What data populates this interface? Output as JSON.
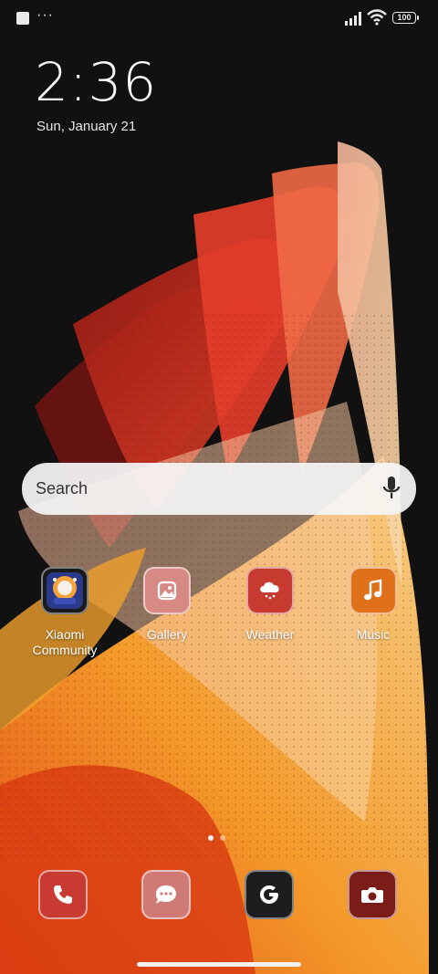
{
  "status_bar": {
    "dots": "···",
    "battery": "100"
  },
  "clock": {
    "time": "2:36",
    "date": "Sun, January 21"
  },
  "search": {
    "label": "Search"
  },
  "apps": [
    {
      "label": "Xiaomi Community",
      "icon": "xiaomi-community-icon",
      "color": "#1a2a6a"
    },
    {
      "label": "Gallery",
      "icon": "gallery-icon",
      "color": "#d78a84"
    },
    {
      "label": "Weather",
      "icon": "weather-icon",
      "color": "#c63a2f"
    },
    {
      "label": "Music",
      "icon": "music-icon",
      "color": "#e0701a"
    }
  ],
  "dock": [
    {
      "icon": "phone-icon",
      "color": "#c83a32"
    },
    {
      "icon": "messages-icon",
      "color": "#d07a76"
    },
    {
      "icon": "google-icon",
      "color": "#1d1d1f"
    },
    {
      "icon": "camera-icon",
      "color": "#7a1c18"
    }
  ],
  "colors": {
    "background": "#111111",
    "accent_red": "#d8362b",
    "accent_orange": "#f0a23c"
  }
}
